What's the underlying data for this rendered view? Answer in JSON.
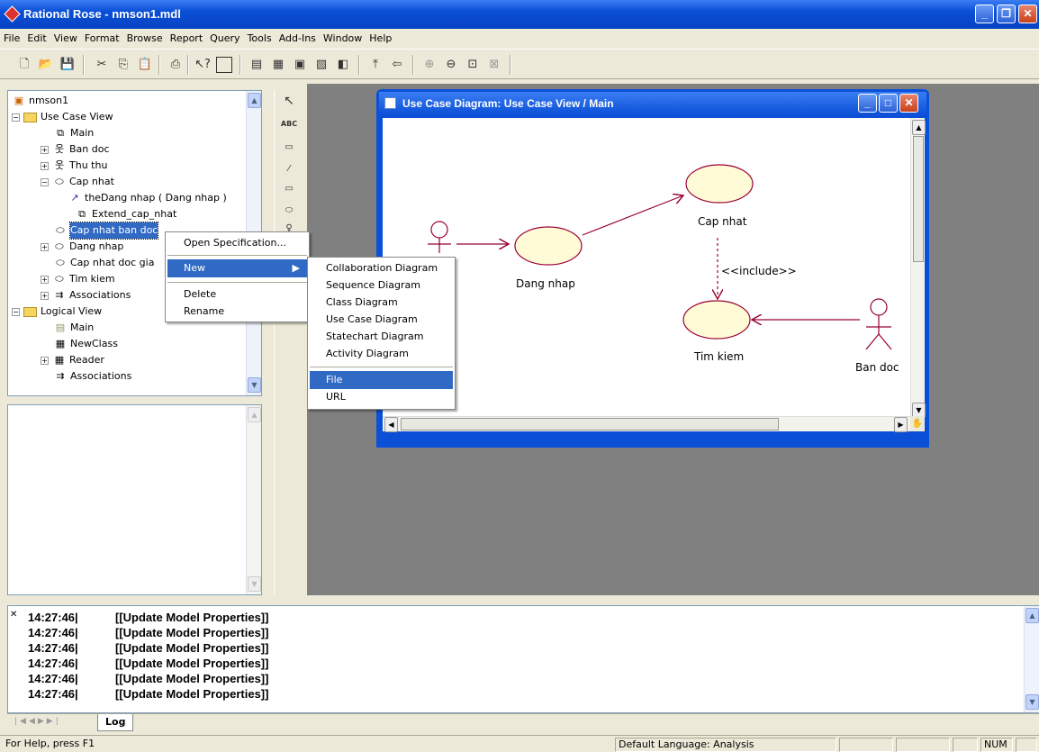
{
  "app": {
    "title": "Rational Rose - nmson1.mdl",
    "colors": {
      "titlebar": "#0a4fd6",
      "selection": "#316ac5",
      "usecase_fill": "#fffbd6",
      "assoc_line": "#990033",
      "mdi_background": "#808080"
    }
  },
  "menubar": [
    "File",
    "Edit",
    "View",
    "Format",
    "Browse",
    "Report",
    "Query",
    "Tools",
    "Add-Ins",
    "Window",
    "Help"
  ],
  "toolbar": {
    "icons": [
      "new-icon",
      "open-icon",
      "save-icon",
      "cut-icon",
      "copy-icon",
      "paste-icon",
      "print-icon",
      "context-help-icon",
      "view-doc-icon",
      "class-diagram-icon",
      "interaction-diagram-icon",
      "component-diagram-icon",
      "deployment-diagram-icon",
      "state-diagram-icon",
      "parent-icon",
      "previous-icon",
      "zoom-in-icon",
      "zoom-out-icon",
      "fit-window-icon",
      "undo-fit-icon"
    ]
  },
  "browser": {
    "tree": [
      {
        "label": "nmson1",
        "icon": "model-icon",
        "depth": 0
      },
      {
        "label": "Use Case View",
        "icon": "folder-icon",
        "depth": 1,
        "expander": "−"
      },
      {
        "label": "Main",
        "icon": "diagram-icon",
        "depth": 2
      },
      {
        "label": "Ban doc",
        "icon": "actor-icon",
        "depth": 2,
        "expander": "+"
      },
      {
        "label": "Thu thu",
        "icon": "actor-icon",
        "depth": 2,
        "expander": "+"
      },
      {
        "label": "Cap nhat",
        "icon": "usecase-icon",
        "depth": 2,
        "expander": "−"
      },
      {
        "label": "theDang nhap ( Dang nhap )",
        "icon": "dependency-icon",
        "depth": 3
      },
      {
        "label": "Extend_cap_nhat",
        "icon": "diagram-icon",
        "depth": 3
      },
      {
        "label": "Cap nhat ban doc",
        "icon": "usecase-icon",
        "depth": 2,
        "selected": true
      },
      {
        "label": "Dang nhap",
        "icon": "usecase-icon",
        "depth": 2,
        "expander": "+"
      },
      {
        "label": "Cap nhat doc gia",
        "icon": "usecase-icon",
        "depth": 2
      },
      {
        "label": "Tim kiem",
        "icon": "usecase-icon",
        "depth": 2,
        "expander": "+"
      },
      {
        "label": "Associations",
        "icon": "associations-icon",
        "depth": 2,
        "expander": "+"
      },
      {
        "label": "Logical View",
        "icon": "folder-icon",
        "depth": 1,
        "expander": "−"
      },
      {
        "label": "Main",
        "icon": "class-diagram-icon",
        "depth": 2
      },
      {
        "label": "NewClass",
        "icon": "class-icon",
        "depth": 2
      },
      {
        "label": "Reader",
        "icon": "class-icon",
        "depth": 2,
        "expander": "+"
      },
      {
        "label": "Associations",
        "icon": "associations-icon",
        "depth": 2
      }
    ]
  },
  "palette": {
    "tools": [
      {
        "name": "selection-tool",
        "glyph": "↖"
      },
      {
        "name": "text-tool",
        "glyph": "ABC"
      },
      {
        "name": "note-tool",
        "glyph": "▭"
      },
      {
        "name": "anchor-note-tool",
        "glyph": "⁄"
      },
      {
        "name": "package-tool",
        "glyph": "▭"
      },
      {
        "name": "use-case-tool",
        "glyph": "⬭"
      },
      {
        "name": "actor-tool",
        "glyph": "♀"
      }
    ]
  },
  "diagram_window": {
    "title": "Use Case Diagram: Use Case View / Main",
    "usecases": {
      "dang_nhap": "Dang nhap",
      "cap_nhat": "Cap nhat",
      "tim_kiem": "Tim kiem"
    },
    "actors": {
      "ban_doc": "Ban doc"
    },
    "stereotype": "<<include>>"
  },
  "context_menu": {
    "items": [
      "Open Specification...",
      "New",
      "Delete",
      "Rename"
    ],
    "highlighted": "New"
  },
  "submenu": {
    "items": [
      "Collaboration Diagram",
      "Sequence Diagram",
      "Class Diagram",
      "Use Case Diagram",
      "Statechart Diagram",
      "Activity Diagram",
      "File",
      "URL"
    ],
    "highlighted": "File"
  },
  "log": {
    "lines": [
      {
        "time": "14:27:46|",
        "msg": "[[Update Model Properties]]"
      },
      {
        "time": "14:27:46|",
        "msg": "[[Update Model Properties]]"
      },
      {
        "time": "14:27:46|",
        "msg": "[[Update Model Properties]]"
      },
      {
        "time": "14:27:46|",
        "msg": "[[Update Model Properties]]"
      },
      {
        "time": "14:27:46|",
        "msg": "[[Update Model Properties]]"
      },
      {
        "time": "14:27:46|",
        "msg": "[[Update Model Properties]]"
      }
    ],
    "tab": "Log"
  },
  "statusbar": {
    "help": "For Help, press F1",
    "language": "Default Language: Analysis",
    "num": "NUM"
  }
}
